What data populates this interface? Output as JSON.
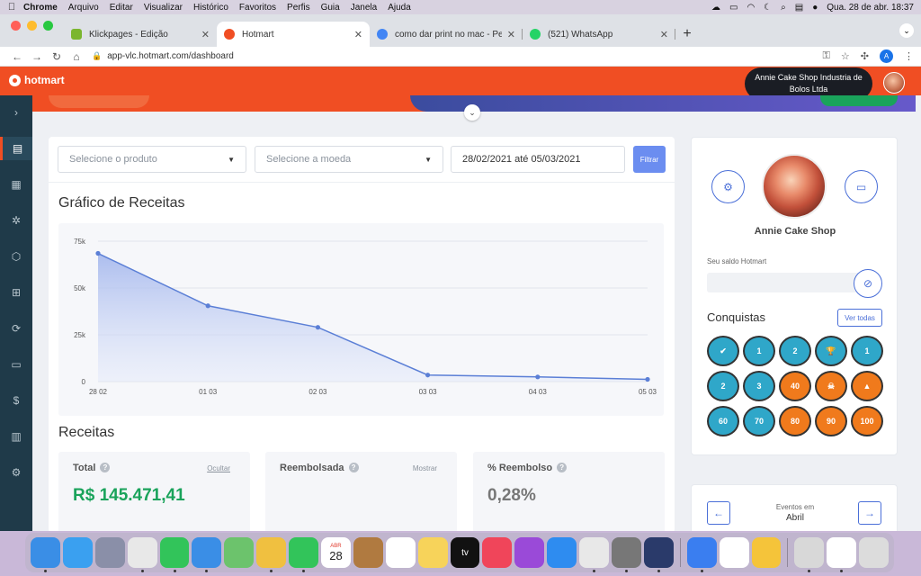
{
  "menubar": {
    "items": [
      "Chrome",
      "Arquivo",
      "Editar",
      "Visualizar",
      "Histórico",
      "Favoritos",
      "Perfis",
      "Guia",
      "Janela",
      "Ajuda"
    ],
    "datetime": "Qua. 28 de abr.  18:37"
  },
  "tabs": [
    {
      "title": "Klickpages - Edição",
      "favicon_color": "#7bb62f",
      "active": false
    },
    {
      "title": "Hotmart",
      "favicon_color": "#f04e23",
      "active": true
    },
    {
      "title": "como dar print no mac - Pesqui",
      "favicon_color": "#4285f4",
      "active": false
    },
    {
      "title": "(521) WhatsApp",
      "favicon_color": "#25d366",
      "active": false
    }
  ],
  "omnibox": {
    "url": "app-vlc.hotmart.com/dashboard"
  },
  "profile_initial": "A",
  "header": {
    "logo_text": "hotmart",
    "user_bubble": "Annie Cake Shop Industria de Bolos Ltda"
  },
  "filters": {
    "product_placeholder": "Selecione o produto",
    "currency_placeholder": "Selecione a moeda",
    "date_range": "28/02/2021 até 05/03/2021",
    "filter_label": "Filtrar"
  },
  "chart_title": "Gráfico de Receitas",
  "chart_data": {
    "type": "area",
    "categories": [
      "28 02",
      "01 03",
      "02 03",
      "03 03",
      "04 03",
      "05 03"
    ],
    "values": [
      68500,
      40500,
      29000,
      3500,
      2500,
      1200
    ],
    "yticks": [
      0,
      25000,
      50000,
      75000
    ],
    "ytick_labels": [
      "0",
      "25k",
      "50k",
      "75k"
    ],
    "ylim": [
      0,
      75000
    ],
    "grid": true,
    "color": "#5b7fd6"
  },
  "receitas": {
    "title": "Receitas",
    "cards": [
      {
        "label": "Total",
        "action": "Ocultar",
        "value": "R$ 145.471,41",
        "color": "#1aa35b"
      },
      {
        "label": "Reembolsada",
        "action": "Mostrar",
        "value": "",
        "color": "#333333"
      },
      {
        "label": "% Reembolso",
        "action": "",
        "value": "0,28%",
        "color": "#777777"
      }
    ]
  },
  "profile": {
    "name": "Annie Cake Shop",
    "saldo_label": "Seu saldo Hotmart",
    "conquistas_title": "Conquistas",
    "ver_todas": "Ver todas",
    "badges": [
      {
        "text": "✔",
        "bg": "#2fa7c9"
      },
      {
        "text": "1",
        "bg": "#2fa7c9"
      },
      {
        "text": "2",
        "bg": "#2fa7c9"
      },
      {
        "text": "🏆",
        "bg": "#2fa7c9"
      },
      {
        "text": "1",
        "bg": "#2fa7c9"
      },
      {
        "text": "2",
        "bg": "#2fa7c9"
      },
      {
        "text": "3",
        "bg": "#2fa7c9"
      },
      {
        "text": "40",
        "bg": "#f07a1c"
      },
      {
        "text": "☠",
        "bg": "#f07a1c"
      },
      {
        "text": "▲",
        "bg": "#f07a1c"
      },
      {
        "text": "60",
        "bg": "#2fa7c9"
      },
      {
        "text": "70",
        "bg": "#2fa7c9"
      },
      {
        "text": "80",
        "bg": "#f07a1c"
      },
      {
        "text": "90",
        "bg": "#f07a1c"
      },
      {
        "text": "100",
        "bg": "#f07a1c"
      }
    ]
  },
  "events": {
    "label": "Eventos em",
    "month": "Abril"
  },
  "dock": {
    "calendar_month": "ABR",
    "calendar_day": "28",
    "tv_label": "tv",
    "apps": [
      {
        "name": "finder",
        "bg": "#3a8ee6"
      },
      {
        "name": "safari",
        "bg": "#3aa0f0"
      },
      {
        "name": "launchpad",
        "bg": "#8a8fa8"
      },
      {
        "name": "chrome",
        "bg": "#e8e8e8"
      },
      {
        "name": "messages",
        "bg": "#32c45a"
      },
      {
        "name": "mail",
        "bg": "#3a8ee6"
      },
      {
        "name": "maps",
        "bg": "#6cc36c"
      },
      {
        "name": "photos",
        "bg": "#f0c040"
      },
      {
        "name": "facetime",
        "bg": "#32c45a"
      },
      {
        "name": "calendar",
        "bg": "#ffffff"
      },
      {
        "name": "notes-brown",
        "bg": "#b07a40"
      },
      {
        "name": "reminders",
        "bg": "#ffffff"
      },
      {
        "name": "notes",
        "bg": "#f7d35a"
      },
      {
        "name": "tv",
        "bg": "#111111"
      },
      {
        "name": "music",
        "bg": "#f0455a"
      },
      {
        "name": "podcasts",
        "bg": "#9a4ad8"
      },
      {
        "name": "app-store",
        "bg": "#2e8cf0"
      },
      {
        "name": "textedit",
        "bg": "#e8e8e8"
      },
      {
        "name": "system-preferences",
        "bg": "#777777"
      },
      {
        "name": "quicktime",
        "bg": "#2a3a6a"
      },
      {
        "name": "messenger",
        "bg": "#3a7ef0"
      },
      {
        "name": "document",
        "bg": "#ffffff"
      },
      {
        "name": "weather",
        "bg": "#f5c43a"
      },
      {
        "name": "preview",
        "bg": "#d8d8d8"
      },
      {
        "name": "sheet",
        "bg": "#ffffff"
      },
      {
        "name": "trash",
        "bg": "#dcdcdc"
      }
    ]
  }
}
